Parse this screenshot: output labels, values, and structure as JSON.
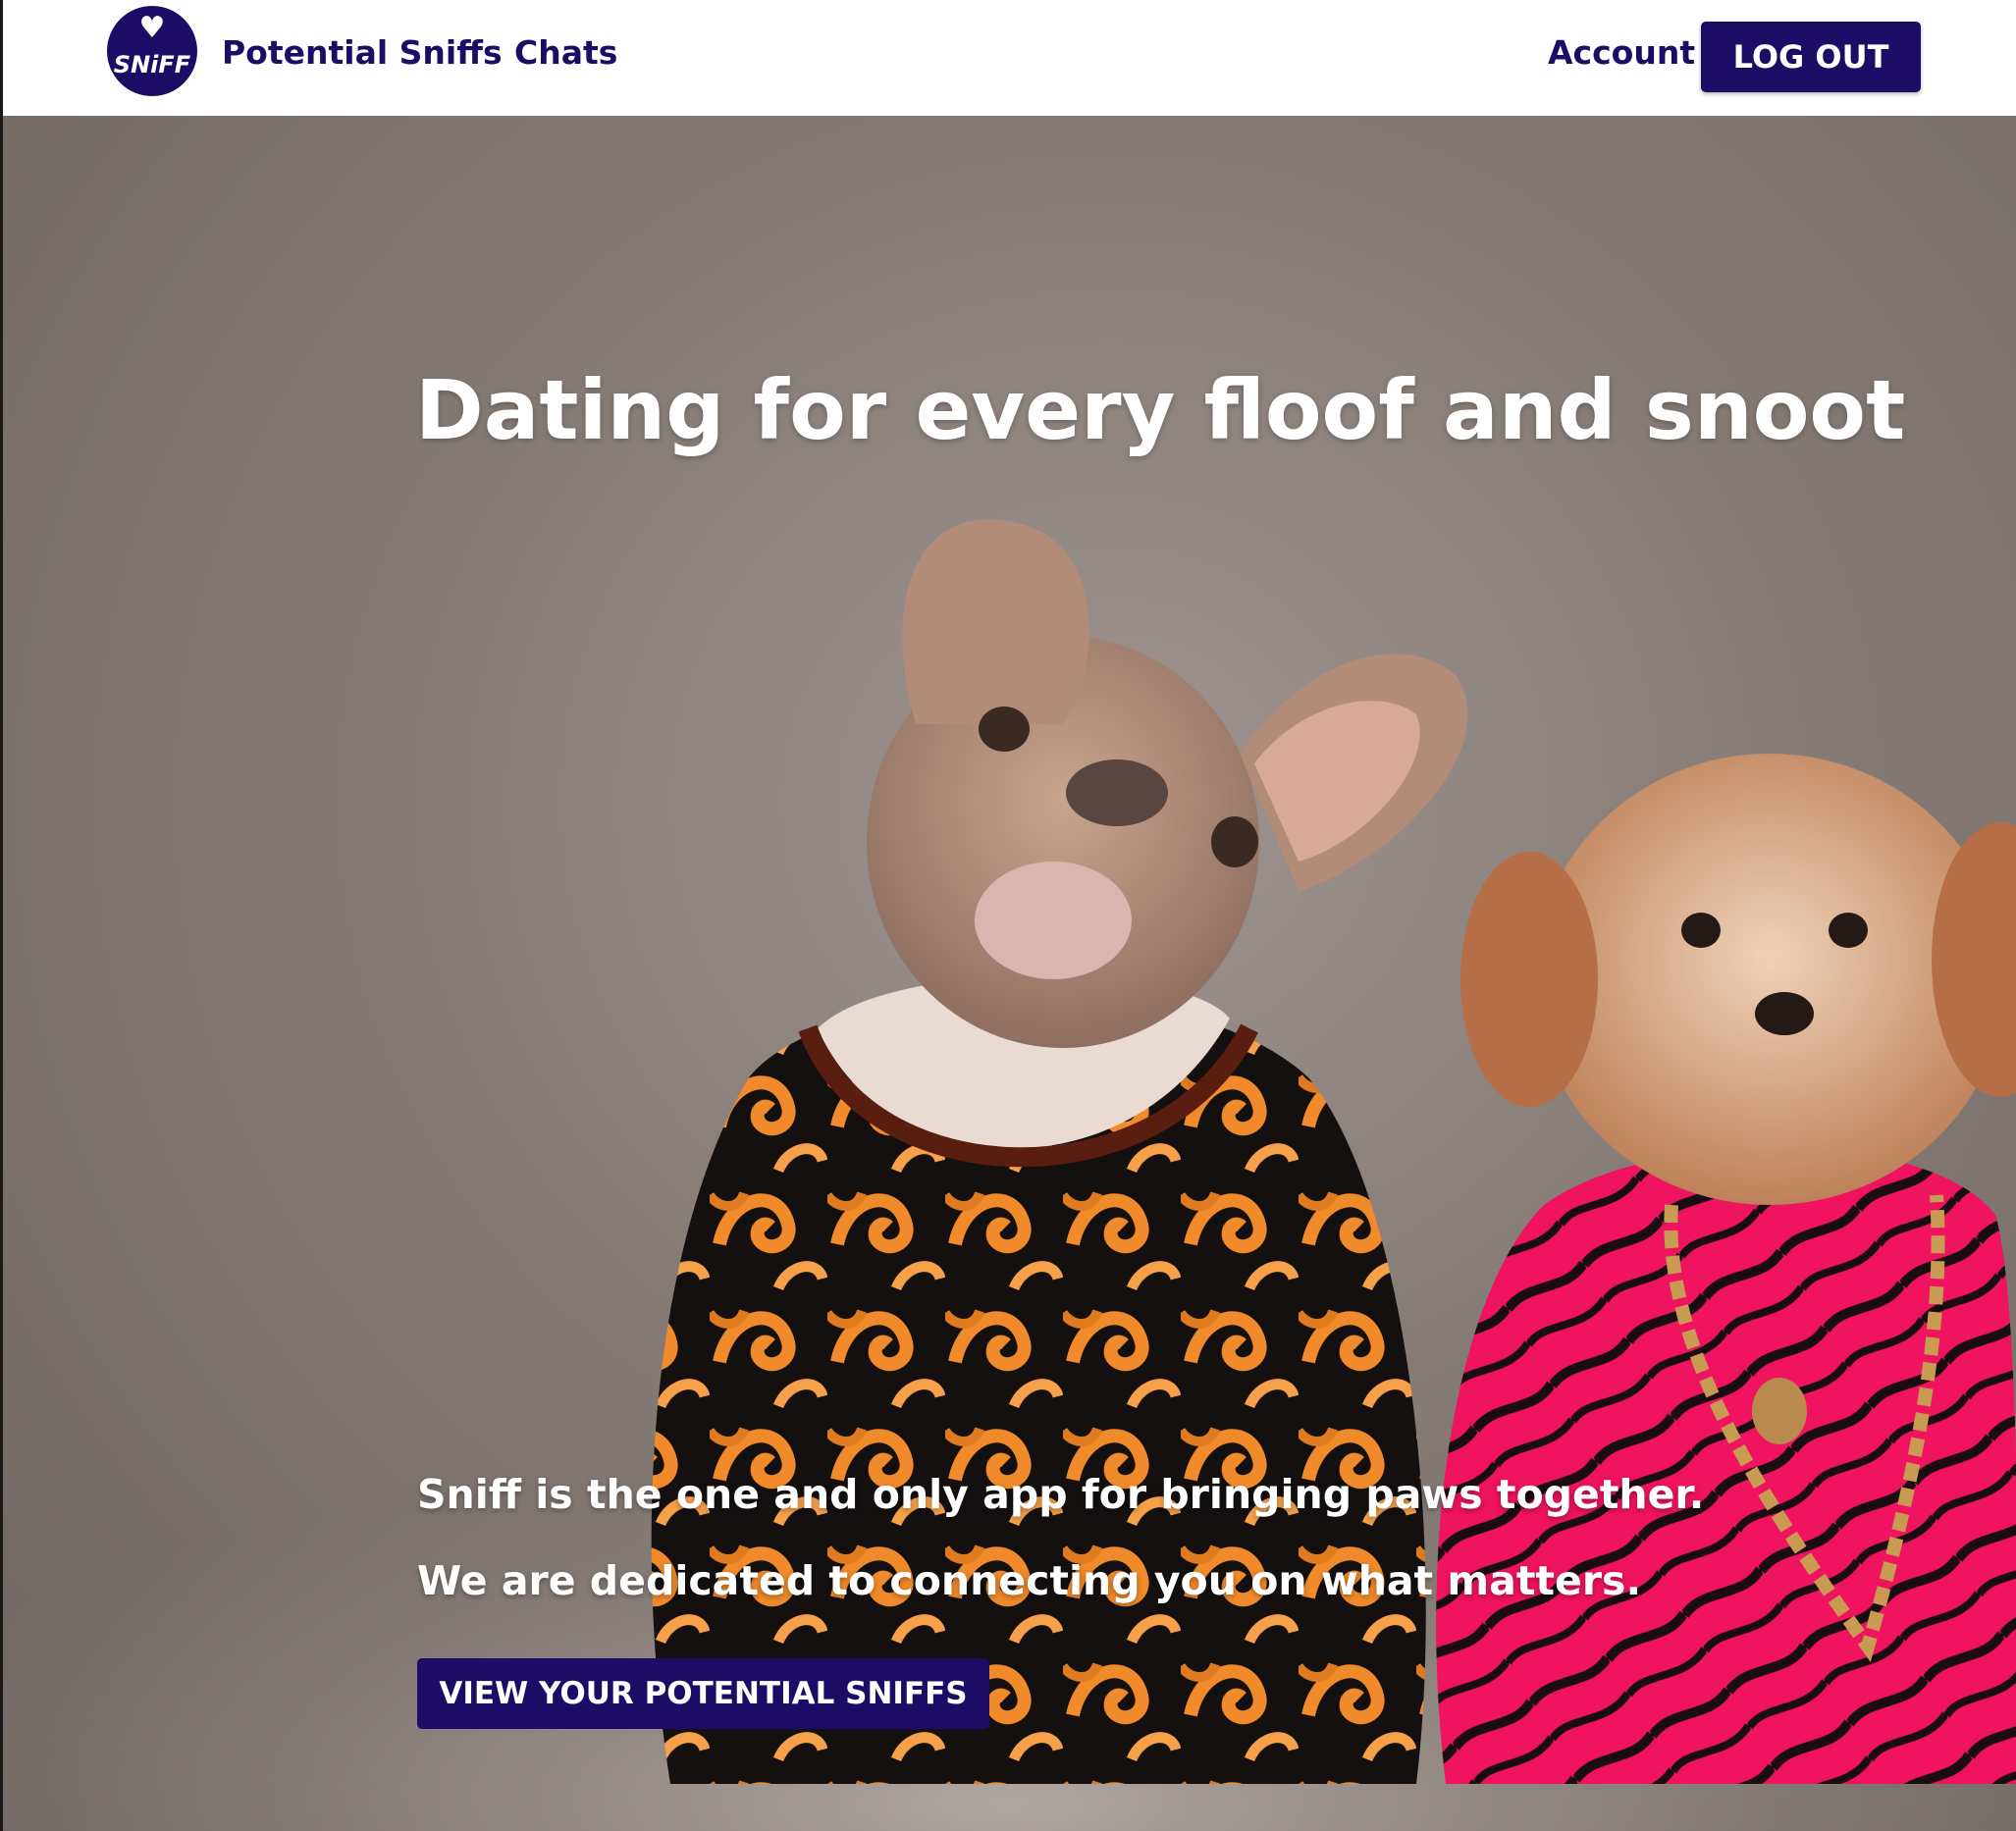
{
  "nav": {
    "logo_text": "SNiFF",
    "links": [
      "Potential Sniffs",
      "Chats"
    ],
    "account_label": "Account",
    "logout_label": "LOG OUT"
  },
  "hero": {
    "title": "Dating for every floof and snoot",
    "lines": [
      "Sniff is the one and only app for bringing paws together.",
      "We are dedicated to connecting you on what matters."
    ],
    "cta_label": "VIEW YOUR POTENTIAL SNIFFS"
  },
  "colors": {
    "brand": "#1c0c66",
    "nav_background": "#ffffff",
    "hero_backdrop": "#857b76",
    "hero_text": "#ffffff"
  },
  "icons": {
    "logo": "heart-paw-logo-icon"
  }
}
